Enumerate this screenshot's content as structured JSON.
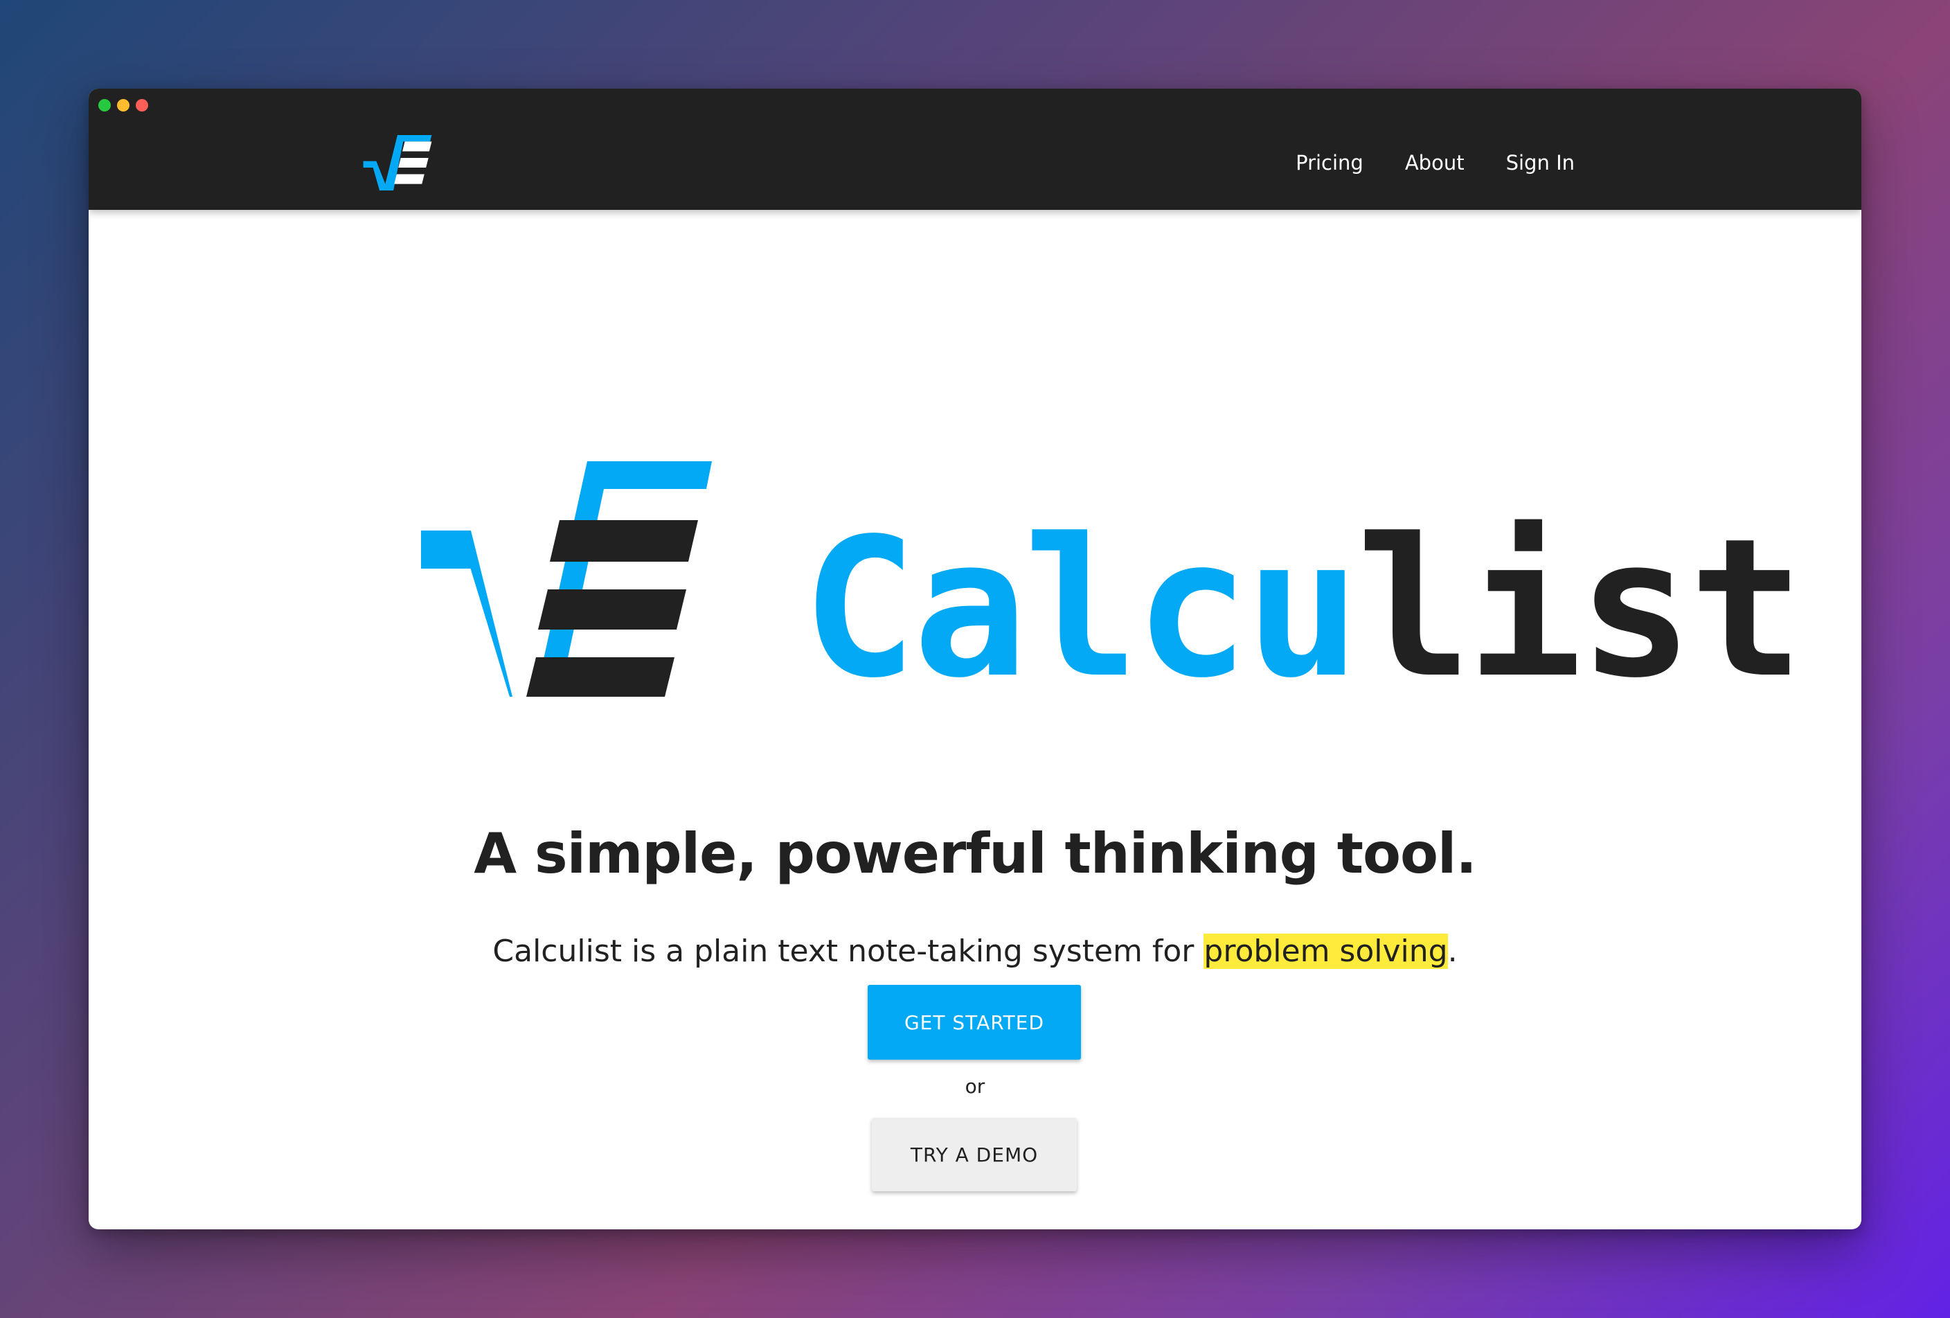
{
  "window": {
    "traffic_lights": [
      "close",
      "minimize",
      "zoom"
    ]
  },
  "navbar": {
    "logo_icon": "calculist-sqrt-logo-icon",
    "links": [
      {
        "label": "Pricing"
      },
      {
        "label": "About"
      },
      {
        "label": "Sign In"
      }
    ]
  },
  "hero": {
    "logo_icon": "calculist-sqrt-logo-icon",
    "wordmark_blue": "Calcu",
    "wordmark_dark": "list",
    "headline": "A simple, powerful thinking tool.",
    "subline_prefix": "Calculist is a plain text note-taking system for ",
    "subline_highlight": "problem solving",
    "subline_suffix": ".",
    "primary_button": "GET STARTED",
    "or_text": "or",
    "secondary_button": "TRY A DEMO"
  },
  "colors": {
    "brand_blue": "#03a9f4",
    "dark": "#212121",
    "highlight": "#ffeb3b",
    "navbar": "#212121",
    "secondary_button": "#eeeeee"
  }
}
